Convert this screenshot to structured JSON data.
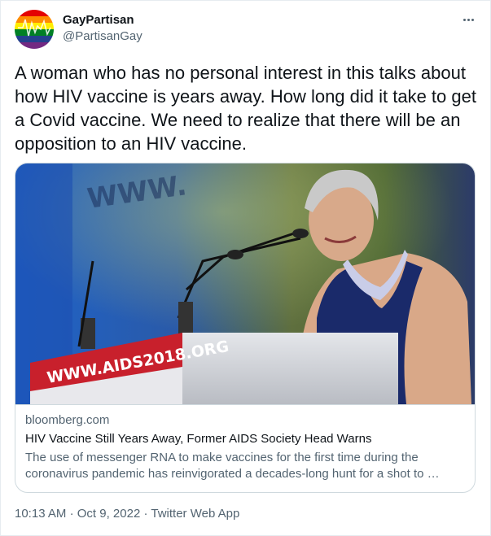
{
  "user": {
    "display_name": "GayPartisan",
    "handle": "@PartisanGay",
    "avatar_icon": "rainbow-flag-avatar-icon"
  },
  "more_icon": "more-horizontal-icon",
  "tweet": {
    "text": "A woman who has no personal interest in this talks about how HIV vaccine is years away. How long did it take to get a Covid vaccine. We need to realize that there will be an opposition to an HIV vaccine."
  },
  "card": {
    "image_banner_text": "WWW.AIDS2018.ORG",
    "domain": "bloomberg.com",
    "title": "HIV Vaccine Still Years Away, Former AIDS Society Head Warns",
    "description": "The use of messenger RNA to make vaccines for the first time during the coronavirus pandemic has reinvigorated a decades-long hunt for a shot to …"
  },
  "meta": {
    "time": "10:13 AM",
    "separator": "·",
    "date": "Oct 9, 2022",
    "source": "Twitter Web App"
  },
  "colors": {
    "text_primary": "#0f1419",
    "text_secondary": "#536471",
    "border": "#cfd9de",
    "banner_red": "#c8202c"
  }
}
